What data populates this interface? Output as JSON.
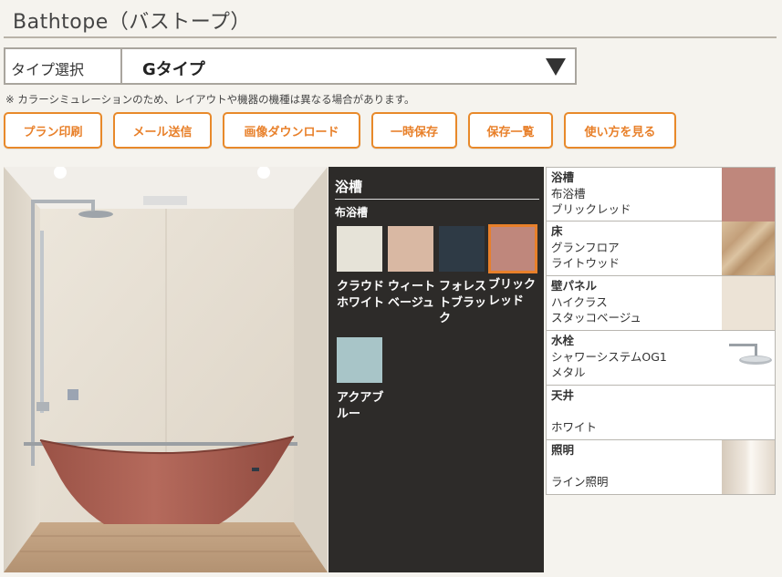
{
  "page": {
    "title": "Bathtope（バストープ）"
  },
  "type_select": {
    "label": "タイプ選択",
    "value": "Gタイプ"
  },
  "note": "※ カラーシミュレーションのため、レイアウトや機器の機種は異なる場合があります。",
  "buttons": [
    {
      "label": "プラン印刷"
    },
    {
      "label": "メール送信"
    },
    {
      "label": "画像ダウンロード"
    },
    {
      "label": "一時保存"
    },
    {
      "label": "保存一覧"
    },
    {
      "label": "使い方を見る"
    }
  ],
  "panel": {
    "section": "浴槽",
    "subsection": "布浴槽",
    "swatches": [
      {
        "name": "クラウドホワイト",
        "color": "#e6e3d8",
        "selected": false
      },
      {
        "name": "ウィートベージュ",
        "color": "#d9b8a3",
        "selected": false
      },
      {
        "name": "フォレストブラック",
        "color": "#2e3a45",
        "selected": false
      },
      {
        "name": "ブリックレッド",
        "color": "#bf877c",
        "selected": true
      },
      {
        "name": "アクアブルー",
        "color": "#a8c5c8",
        "selected": false
      }
    ]
  },
  "specs": [
    {
      "head": "浴槽",
      "line1": "布浴槽",
      "line2": "ブリックレッド",
      "thumb": "brick-swatch",
      "color": "#bf877c"
    },
    {
      "head": "床",
      "line1": "グランフロア",
      "line2": "ライトウッド",
      "thumb": "wood-floor",
      "color": "#c9ab88"
    },
    {
      "head": "壁パネル",
      "line1": "ハイクラス",
      "line2": "スタッコベージュ",
      "thumb": "stucco-wall",
      "color": "#ece3d6"
    },
    {
      "head": "水栓",
      "line1": "シャワーシステムOG1",
      "line2": "メタル",
      "thumb": "shower-head",
      "color": "#ffffff"
    },
    {
      "head": "天井",
      "line1": "",
      "line2": "ホワイト",
      "thumb": "none",
      "color": "#ffffff"
    },
    {
      "head": "照明",
      "line1": "",
      "line2": "ライン照明",
      "thumb": "line-light",
      "color": "#e4dbd0"
    }
  ]
}
